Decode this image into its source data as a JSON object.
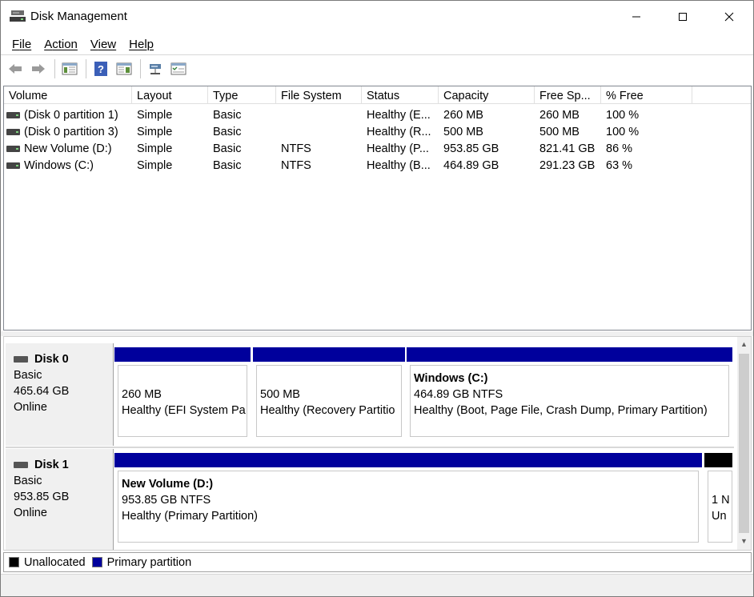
{
  "window": {
    "title": "Disk Management"
  },
  "menu": [
    {
      "key": "F",
      "rest": "ile"
    },
    {
      "key": "A",
      "rest": "ction"
    },
    {
      "key": "V",
      "rest": "iew"
    },
    {
      "key": "H",
      "rest": "elp"
    }
  ],
  "toolbar": {
    "icons": [
      "back-arrow-icon",
      "forward-arrow-icon",
      "show-hide-console-tree-icon",
      "help-icon",
      "properties-icon",
      "connect-virtual-disk-icon",
      "settings-checklist-icon"
    ]
  },
  "columns": [
    "Volume",
    "Layout",
    "Type",
    "File System",
    "Status",
    "Capacity",
    "Free Sp...",
    "% Free"
  ],
  "volumes": [
    {
      "volume": "(Disk 0 partition 1)",
      "layout": "Simple",
      "type": "Basic",
      "fs": "",
      "status": "Healthy (E...",
      "capacity": "260 MB",
      "free": "260 MB",
      "pct": "100 %"
    },
    {
      "volume": "(Disk 0 partition 3)",
      "layout": "Simple",
      "type": "Basic",
      "fs": "",
      "status": "Healthy (R...",
      "capacity": "500 MB",
      "free": "500 MB",
      "pct": "100 %"
    },
    {
      "volume": "New Volume (D:)",
      "layout": "Simple",
      "type": "Basic",
      "fs": "NTFS",
      "status": "Healthy (P...",
      "capacity": "953.85 GB",
      "free": "821.41 GB",
      "pct": "86 %"
    },
    {
      "volume": "Windows (C:)",
      "layout": "Simple",
      "type": "Basic",
      "fs": "NTFS",
      "status": "Healthy (B...",
      "capacity": "464.89 GB",
      "free": "291.23 GB",
      "pct": "63 %"
    }
  ],
  "disks": [
    {
      "name": "Disk 0",
      "kind": "Basic",
      "size": "465.64 GB",
      "state": "Online",
      "partitions": [
        {
          "name": "",
          "size": "260 MB",
          "status": "Healthy (EFI System Pa"
        },
        {
          "name": "",
          "size": "500 MB",
          "status": "Healthy (Recovery Partitio"
        },
        {
          "name": "Windows  (C:)",
          "size": "464.89 GB NTFS",
          "status": "Healthy (Boot, Page File, Crash Dump, Primary Partition)"
        }
      ]
    },
    {
      "name": "Disk 1",
      "kind": "Basic",
      "size": "953.85 GB",
      "state": "Online",
      "partitions": [
        {
          "name": "New Volume  (D:)",
          "size": "953.85 GB NTFS",
          "status": "Healthy (Primary Partition)"
        },
        {
          "name": "",
          "size": "1 N",
          "status": "Un"
        }
      ]
    }
  ],
  "legend": [
    {
      "label": "Unallocated",
      "color": "#000000"
    },
    {
      "label": "Primary partition",
      "color": "#00009c"
    }
  ]
}
